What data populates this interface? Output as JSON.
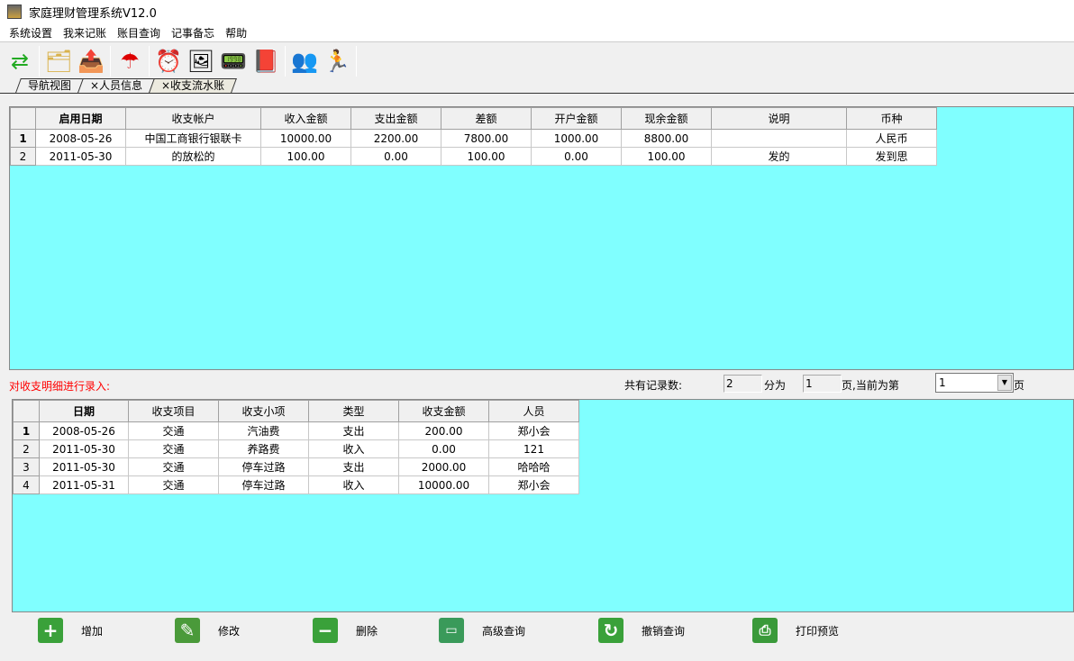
{
  "window": {
    "title": "家庭理财管理系统V12.0"
  },
  "menu": [
    "系统设置",
    "我来记账",
    "账目查询",
    "记事备忘",
    "帮助"
  ],
  "tabs": [
    "导航视图",
    "×人员信息",
    "×收支流水账"
  ],
  "accounts": {
    "headers": [
      "启用日期",
      "收支帐户",
      "收入金额",
      "支出金额",
      "差额",
      "开户金额",
      "现余金额",
      "说明",
      "币种"
    ],
    "rows": [
      {
        "n": "1",
        "c": [
          "2008-05-26",
          "中国工商银行银联卡",
          "10000.00",
          "2200.00",
          "7800.00",
          "1000.00",
          "8800.00",
          "",
          "人民币"
        ]
      },
      {
        "n": "2",
        "c": [
          "2011-05-30",
          "的放松的",
          "100.00",
          "0.00",
          "100.00",
          "0.00",
          "100.00",
          "发的",
          "发到思"
        ]
      }
    ]
  },
  "mid": {
    "entry_label": "对收支明细进行录入:",
    "total_label": "共有记录数:",
    "total": "2",
    "split_label": "分为",
    "pages": "1",
    "current_label": "页,当前为第",
    "current": "1",
    "page_suffix": "页"
  },
  "details": {
    "headers": [
      "日期",
      "收支项目",
      "收支小项",
      "类型",
      "收支金额",
      "人员"
    ],
    "rows": [
      {
        "n": "1",
        "c": [
          "2008-05-26",
          "交通",
          "汽油费",
          "支出",
          "200.00",
          "郑小会"
        ]
      },
      {
        "n": "2",
        "c": [
          "2011-05-30",
          "交通",
          "养路费",
          "收入",
          "0.00",
          "121"
        ]
      },
      {
        "n": "3",
        "c": [
          "2011-05-30",
          "交通",
          "停车过路",
          "支出",
          "2000.00",
          "哈哈哈"
        ]
      },
      {
        "n": "4",
        "c": [
          "2011-05-31",
          "交通",
          "停车过路",
          "收入",
          "10000.00",
          "郑小会"
        ]
      }
    ]
  },
  "buttons": [
    "增加",
    "修改",
    "删除",
    "高级查询",
    "撤销查询",
    "打印预览"
  ]
}
